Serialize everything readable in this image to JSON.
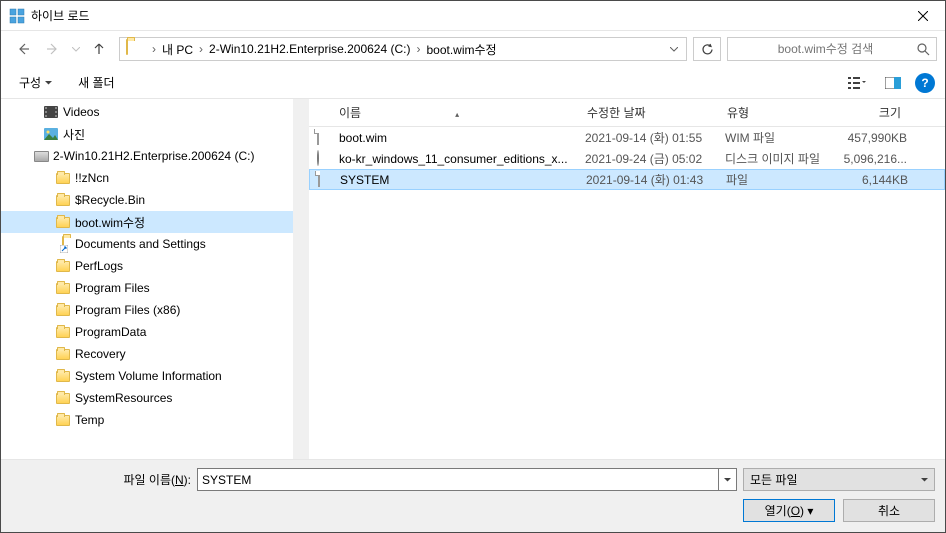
{
  "title": "하이브 로드",
  "breadcrumb": [
    "내 PC",
    "2-Win10.21H2.Enterprise.200624 (C:)",
    "boot.wim수정"
  ],
  "search_placeholder": "boot.wim수정 검색",
  "toolbar": {
    "organize": "구성",
    "new_folder": "새 폴더"
  },
  "tree": [
    {
      "label": "Videos",
      "indent": 28,
      "icon": "video"
    },
    {
      "label": "사진",
      "indent": 28,
      "icon": "pictures"
    },
    {
      "label": "2-Win10.21H2.Enterprise.200624 (C:)",
      "indent": 18,
      "icon": "drive"
    },
    {
      "label": "!!zNcn",
      "indent": 40,
      "icon": "folder"
    },
    {
      "label": "$Recycle.Bin",
      "indent": 40,
      "icon": "folder"
    },
    {
      "label": "boot.wim수정",
      "indent": 40,
      "icon": "folder",
      "selected": true
    },
    {
      "label": "Documents and Settings",
      "indent": 40,
      "icon": "shortcut"
    },
    {
      "label": "PerfLogs",
      "indent": 40,
      "icon": "folder"
    },
    {
      "label": "Program Files",
      "indent": 40,
      "icon": "folder"
    },
    {
      "label": "Program Files (x86)",
      "indent": 40,
      "icon": "folder"
    },
    {
      "label": "ProgramData",
      "indent": 40,
      "icon": "folder"
    },
    {
      "label": "Recovery",
      "indent": 40,
      "icon": "folder"
    },
    {
      "label": "System Volume Information",
      "indent": 40,
      "icon": "folder"
    },
    {
      "label": "SystemResources",
      "indent": 40,
      "icon": "folder"
    },
    {
      "label": "Temp",
      "indent": 40,
      "icon": "folder"
    }
  ],
  "columns": {
    "name": "이름",
    "date": "수정한 날짜",
    "type": "유형",
    "size": "크기"
  },
  "files": [
    {
      "name": "boot.wim",
      "date": "2021-09-14 (화) 01:55",
      "type": "WIM 파일",
      "size": "457,990KB",
      "icon": "file"
    },
    {
      "name": "ko-kr_windows_11_consumer_editions_x...",
      "date": "2021-09-24 (금) 05:02",
      "type": "디스크 이미지 파일",
      "size": "5,096,216...",
      "icon": "disc"
    },
    {
      "name": "SYSTEM",
      "date": "2021-09-14 (화) 01:43",
      "type": "파일",
      "size": "6,144KB",
      "icon": "file",
      "selected": true
    }
  ],
  "footer": {
    "filename_label_pre": "파일 이름(",
    "filename_label_u": "N",
    "filename_label_post": "):",
    "filename_value": "SYSTEM",
    "filetype": "모든 파일",
    "open_pre": "열기(",
    "open_u": "O",
    "open_post": ")",
    "cancel": "취소"
  }
}
